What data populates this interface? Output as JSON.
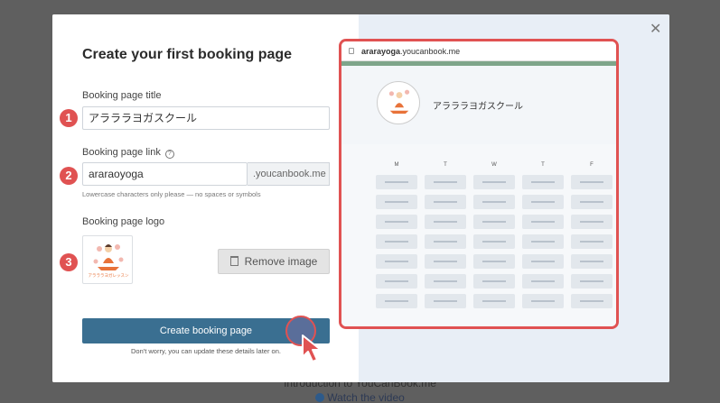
{
  "background": {
    "caption_line1": "Introduction to YouCanBook.me",
    "caption_line2": "Watch the video"
  },
  "modal": {
    "title": "Create your first booking page",
    "close_icon": "close-icon",
    "fields": {
      "title_label": "Booking page title",
      "title_value": "アラララヨガスクール",
      "link_label": "Booking page link",
      "link_value": "araraoyoga",
      "link_suffix": ".youcanbook.me",
      "link_hint": "Lowercase characters only please — no spaces or symbols",
      "logo_label": "Booking page logo",
      "logo_caption": "アラララヨガレッスン"
    },
    "remove_image_label": "Remove image",
    "create_button_label": "Create booking page",
    "create_hint": "Don't worry, you can update these details later on.",
    "badges": [
      "1",
      "2",
      "3"
    ]
  },
  "preview": {
    "url_bold": "ararayoga",
    "url_rest": ".youcanbook.me",
    "page_name": "アラララヨガスクール",
    "days": [
      "M",
      "T",
      "W",
      "T",
      "F"
    ],
    "slot_rows": 7
  },
  "colors": {
    "accent": "#3a6f91",
    "highlight": "#e05252",
    "stripe": "#7ea58a"
  }
}
